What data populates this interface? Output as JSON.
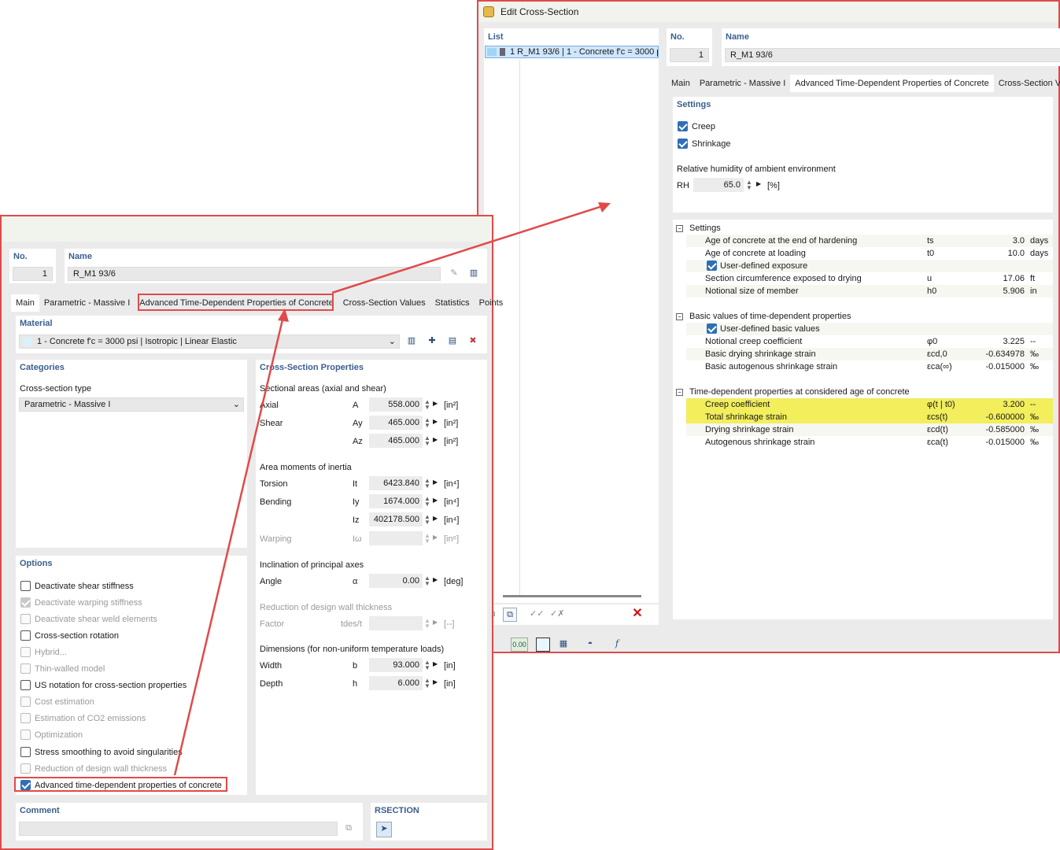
{
  "back_window": {
    "title": "Edit Cross-Section",
    "list_header": "List",
    "list_item": "1  R_M1 93/6 | 1 - Concrete f'c = 3000 p",
    "no_label": "No.",
    "no_value": "1",
    "name_label": "Name",
    "name_value": "R_M1 93/6",
    "tabs": [
      "Main",
      "Parametric - Massive I",
      "Advanced Time-Dependent Properties of Concrete",
      "Cross-Section Va"
    ],
    "settings_title": "Settings",
    "creep_label": "Creep",
    "shrinkage_label": "Shrinkage",
    "humidity_label": "Relative humidity of ambient environment",
    "rh_label": "RH",
    "rh_value": "65.0",
    "rh_unit": "[%]",
    "tree": {
      "settings_group": "Settings",
      "age_hardening_label": "Age of concrete at the end of hardening",
      "age_hardening_sym": "ts",
      "age_hardening_val": "3.0",
      "age_hardening_unit": "days",
      "age_loading_label": "Age of concrete at loading",
      "age_loading_sym": "t0",
      "age_loading_val": "10.0",
      "age_loading_unit": "days",
      "user_exposure_label": "User-defined exposure",
      "circumference_label": "Section circumference exposed to drying",
      "circumference_sym": "u",
      "circumference_val": "17.06",
      "circumference_unit": "ft",
      "notional_size_label": "Notional size of member",
      "notional_size_sym": "h0",
      "notional_size_val": "5.906",
      "notional_size_unit": "in",
      "basic_group": "Basic values of time-dependent properties",
      "user_basic_label": "User-defined basic values",
      "notional_creep_label": "Notional creep coefficient",
      "notional_creep_sym": "φ0",
      "notional_creep_val": "3.225",
      "notional_creep_unit": "--",
      "drying_basic_label": "Basic drying shrinkage strain",
      "drying_basic_sym": "εcd,0",
      "drying_basic_val": "-0.634978",
      "drying_basic_unit": "‰",
      "auto_basic_label": "Basic autogenous shrinkage strain",
      "auto_basic_sym": "εca(∞)",
      "auto_basic_val": "-0.015000",
      "auto_basic_unit": "‰",
      "considered_group": "Time-dependent properties at considered age of concrete",
      "creep_coef_label": "Creep coefficient",
      "creep_coef_sym": "φ(t | t0)",
      "creep_coef_val": "3.200",
      "creep_coef_unit": "--",
      "total_shrink_label": "Total shrinkage strain",
      "total_shrink_sym": "εcs(t)",
      "total_shrink_val": "-0.600000",
      "total_shrink_unit": "‰",
      "drying_shrink_label": "Drying shrinkage strain",
      "drying_shrink_sym": "εcd(t)",
      "drying_shrink_val": "-0.585000",
      "drying_shrink_unit": "‰",
      "auto_shrink_label": "Autogenous shrinkage strain",
      "auto_shrink_sym": "εca(t)",
      "auto_shrink_val": "-0.015000",
      "auto_shrink_unit": "‰"
    },
    "bottom_value_icon": "0.00"
  },
  "front_window": {
    "no_label": "No.",
    "no_value": "1",
    "name_label": "Name",
    "name_value": "R_M1 93/6",
    "tabs": [
      "Main",
      "Parametric - Massive I",
      "Advanced Time-Dependent Properties of Concrete",
      "Cross-Section Values",
      "Statistics",
      "Points"
    ],
    "material_title": "Material",
    "material_value": "1 - Concrete f'c = 3000 psi | Isotropic | Linear Elastic",
    "categories_title": "Categories",
    "cs_type_label": "Cross-section type",
    "cs_type_value": "Parametric - Massive I",
    "options_title": "Options",
    "options": [
      {
        "label": "Deactivate shear stiffness"
      },
      {
        "label": "Deactivate warping stiffness"
      },
      {
        "label": "Deactivate shear weld elements"
      },
      {
        "label": "Cross-section rotation"
      },
      {
        "label": "Hybrid..."
      },
      {
        "label": "Thin-walled model"
      },
      {
        "label": "US notation for cross-section properties"
      },
      {
        "label": "Cost estimation"
      },
      {
        "label": "Estimation of CO2 emissions"
      },
      {
        "label": "Optimization"
      },
      {
        "label": "Stress smoothing to avoid singularities"
      },
      {
        "label": "Reduction of design wall thickness"
      },
      {
        "label": "Advanced time-dependent properties of concrete"
      }
    ],
    "props_title": "Cross-Section Properties",
    "sectional_areas": "Sectional areas (axial and shear)",
    "axial_label": "Axial",
    "axial_sym": "A",
    "axial_val": "558.000",
    "axial_unit": "[in²]",
    "shear_label": "Shear",
    "shear_y_sym": "Ay",
    "shear_y_val": "465.000",
    "shear_y_unit": "[in²]",
    "shear_z_sym": "Az",
    "shear_z_val": "465.000",
    "shear_z_unit": "[in²]",
    "moments_title": "Area moments of inertia",
    "torsion_label": "Torsion",
    "torsion_sym": "It",
    "torsion_val": "6423.840",
    "torsion_unit": "[in⁴]",
    "bending_label": "Bending",
    "bending_y_sym": "Iy",
    "bending_y_val": "1674.000",
    "bending_y_unit": "[in⁴]",
    "bending_z_sym": "Iz",
    "bending_z_val": "402178.500",
    "bending_z_unit": "[in⁴]",
    "warping_label": "Warping",
    "warping_sym": "Iω",
    "warping_unit": "[in⁶]",
    "inclination_title": "Inclination of principal axes",
    "angle_label": "Angle",
    "angle_sym": "α",
    "angle_val": "0.00",
    "angle_unit": "[deg]",
    "reduction_title": "Reduction of design wall thickness",
    "factor_label": "Factor",
    "factor_sym": "tdes/t",
    "factor_unit": "[--]",
    "dimensions_title": "Dimensions (for non-uniform temperature loads)",
    "width_label": "Width",
    "width_sym": "b",
    "width_val": "93.000",
    "width_unit": "[in]",
    "depth_label": "Depth",
    "depth_sym": "h",
    "depth_val": "6.000",
    "depth_unit": "[in]",
    "comment_title": "Comment",
    "rsection_title": "RSECTION"
  },
  "colors": {
    "highlight_red": "#e04a4a",
    "header_blue": "#3a5f8e",
    "checkbox_blue": "#2f6fb7",
    "highlight_yellow": "#f2ee5c"
  }
}
